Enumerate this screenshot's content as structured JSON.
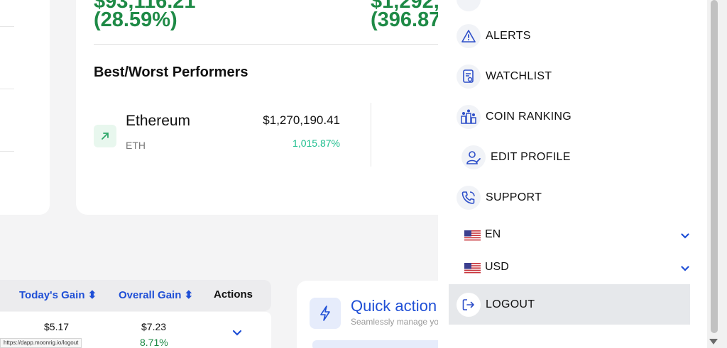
{
  "colors": {
    "accent_blue": "#1f4fd6",
    "gain_green": "#1e8a46",
    "pct_teal": "#1fbf8f",
    "hover_gray": "#e6e8eb"
  },
  "summary": {
    "gain_1_value": "$93,116.21",
    "gain_1_pct": "(28.59%)",
    "gain_2_value": "$1,292,0",
    "gain_2_pct": "(396.87"
  },
  "performers": {
    "title": "Best/Worst Performers",
    "best": {
      "name": "Ethereum",
      "symbol": "ETH",
      "value": "$1,270,190.41",
      "change": "1,015.87%",
      "icon": "arrow-up-right-icon"
    }
  },
  "holdings_table": {
    "headers": {
      "todays_gain": "Today's Gain",
      "overall_gain": "Overall Gain",
      "actions": "Actions"
    },
    "rows": [
      {
        "todays_gain": "$5.17",
        "overall_gain": "$7.23",
        "overall_pct": "8.71%"
      }
    ]
  },
  "quick_actions": {
    "title": "Quick action",
    "subtitle": "Seamlessly manage yo",
    "icon": "lightning-icon"
  },
  "menu": {
    "items": [
      {
        "label": "ALERTS",
        "icon": "alert-triangle-icon"
      },
      {
        "label": "WATCHLIST",
        "icon": "watchlist-icon"
      },
      {
        "label": "COIN RANKING",
        "icon": "ranking-icon"
      },
      {
        "label": "EDIT PROFILE",
        "icon": "user-edit-icon"
      },
      {
        "label": "SUPPORT",
        "icon": "phone-icon"
      }
    ],
    "language": "EN",
    "currency": "USD",
    "logout": "LOGOUT"
  },
  "status_url": "https://dapp.moonrig.io/logout"
}
